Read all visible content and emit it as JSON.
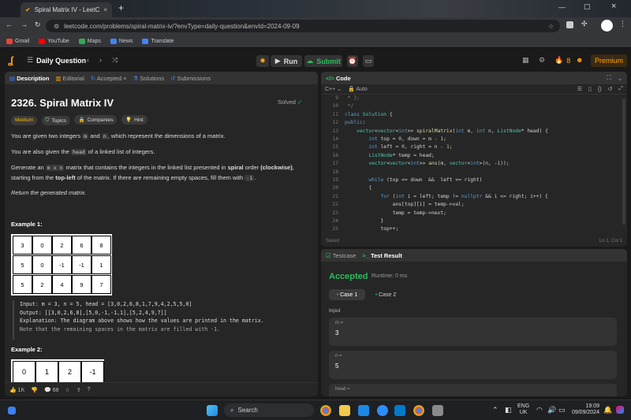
{
  "browser": {
    "tab_title": "Spiral Matrix IV - LeetCode",
    "url": "leetcode.com/problems/spiral-matrix-iv/?envType=daily-question&envId=2024-09-09",
    "bookmarks": [
      "Gmail",
      "YouTube",
      "Maps",
      "News",
      "Translate"
    ]
  },
  "nav": {
    "title": "Daily Question",
    "run": "Run",
    "submit": "Submit",
    "streak": "8",
    "premium": "Premium"
  },
  "desc_tabs": [
    "Description",
    "Editorial",
    "Accepted",
    "Solutions",
    "Submissions"
  ],
  "problem": {
    "title": "2326. Spiral Matrix IV",
    "status": "Solved",
    "tags": [
      "Medium",
      "Topics",
      "Companies",
      "Hint"
    ],
    "p1a": "You are given two integers ",
    "p1m": "m",
    "p1b": " and ",
    "p1n": "n",
    "p1c": ", which represent the dimensions of a matrix.",
    "p2a": "You are also given the ",
    "p2h": "head",
    "p2b": " of a linked list of integers.",
    "p3a": "Generate an ",
    "p3c": "m x n",
    "p3b": " matrix that contains the integers in the linked list presented in ",
    "p3s": "spiral",
    "p3d": " order ",
    "p3cw": "(clockwise)",
    "p3e": ",",
    "p3f": "starting from the ",
    "p3tl": "top-left",
    "p3g": " of the matrix. If there are remaining empty spaces, fill them with ",
    "p3v": "-1",
    "p3h": ".",
    "p4": "Return the generated matrix.",
    "ex1": "Example 1:",
    "grid1": [
      [
        "3",
        "0",
        "2",
        "6",
        "8"
      ],
      [
        "5",
        "0",
        "-1",
        "-1",
        "1"
      ],
      [
        "5",
        "2",
        "4",
        "9",
        "7"
      ]
    ],
    "io_input": "Input: m = 3, n = 5, head = [3,0,2,6,8,1,7,9,4,2,5,5,0]",
    "io_output": "Output: [[3,0,2,6,8],[5,0,-1,-1,1],[5,2,4,9,7]]",
    "io_expl1": "Explanation: The diagram above shows how the values are printed in the matrix.",
    "io_expl2": "Note that the remaining spaces in the matrix are filled with -1.",
    "ex2": "Example 2:",
    "grid2": [
      "0",
      "1",
      "2",
      "-1"
    ],
    "likes": "1K",
    "comments": "68"
  },
  "code": {
    "title": "Code",
    "lang": "C++",
    "mode": "Auto",
    "saved": "Saved",
    "cursor": "Ln 1, Col 1",
    "line_numbers": [
      "9",
      "10",
      "11",
      "12",
      "13",
      "14",
      "15",
      "16",
      "17",
      "18",
      "19",
      "20",
      "21",
      "22",
      "23",
      "24",
      "25"
    ],
    "lines": [
      " * };",
      " */",
      "class Solution {",
      "public:",
      "    vector<vector<int>> spiralMatrix(int m, int n, ListNode* head) {",
      "        int top = 0, down = m - 1;",
      "        int left = 0, right = n - 1;",
      "        ListNode* temp = head;",
      "        vector<vector<int>> ans(m, vector<int>(n, -1));",
      "",
      "        while (top <= down  &&  left <= right)",
      "        {",
      "            for (int i = left; temp != nullptr && i <= right; i++) {",
      "                ans[top][i] = temp->val;",
      "                temp = temp->next;",
      "            }",
      "            top++;"
    ]
  },
  "result": {
    "tab_testcase": "Testcase",
    "tab_result": "Test Result",
    "status": "Accepted",
    "runtime": "Runtime: 0 ms",
    "case1": "Case 1",
    "case2": "Case 2",
    "input_label": "Input",
    "m_label": "m =",
    "m_val": "3",
    "n_label": "n =",
    "n_val": "5",
    "head_label": "head ="
  },
  "taskbar": {
    "search": "Search",
    "lang": "ENG",
    "region": "UK",
    "time": "19:09",
    "date": "09/09/2024"
  },
  "colors": {
    "accent": "#ffa116",
    "green": "#2cbb5d",
    "blue": "#3b82f6"
  }
}
